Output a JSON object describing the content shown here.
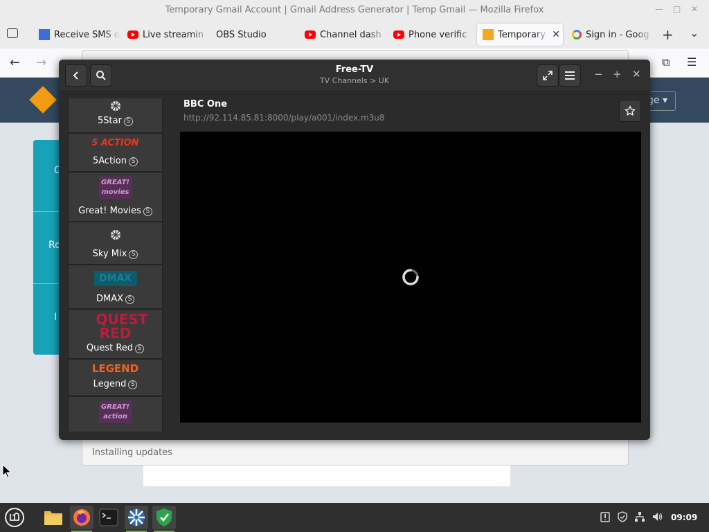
{
  "firefox": {
    "window_title": "Temporary Gmail Account | Gmail Address Generator | Temp Gmail — Mozilla Firefox",
    "tabs": [
      {
        "label": "Receive SMS o",
        "favicon": "sms-favicon"
      },
      {
        "label": "Live streamin",
        "favicon": "youtube-favicon"
      },
      {
        "label": "OBS Studio",
        "favicon": ""
      },
      {
        "label": "Channel dash",
        "favicon": "youtube-favicon"
      },
      {
        "label": "Phone verific",
        "favicon": "youtube-favicon"
      },
      {
        "label": "Temporary",
        "favicon": "mail-favicon",
        "active": true
      },
      {
        "label": "Sign in - Goog",
        "favicon": "google-favicon"
      }
    ],
    "close_glyph": "✕",
    "new_tab_glyph": "+",
    "tab_list_glyph": "⌄",
    "back_glyph": "←",
    "forward_glyph": "→",
    "menu_glyph": "☰"
  },
  "webpage": {
    "lang_button_label": "ge",
    "card_letters": [
      "C",
      "Ro",
      "I"
    ]
  },
  "update_dialog": {
    "status": "Installing updates"
  },
  "freetv": {
    "title": "Free-TV",
    "subtitle": "TV Channels > UK",
    "channels": [
      {
        "name": "5Star"
      },
      {
        "name": "5Action",
        "logo_text": "5 ACTION"
      },
      {
        "name": "Great! Movies",
        "logo_text": "GREAT! movies"
      },
      {
        "name": "Sky Mix"
      },
      {
        "name": "DMAX",
        "logo_text": "DMAX"
      },
      {
        "name": "Quest Red",
        "logo_text": "QUEST RED"
      },
      {
        "name": "Legend",
        "logo_text": "LEGEND"
      },
      {
        "name": "",
        "logo_text": "GREAT! action"
      }
    ],
    "subscribed_mark": "S",
    "selected": {
      "name": "BBC One",
      "url": "http://92.114.85.81:8000/play/a001/index.m3u8"
    },
    "colors": {
      "accent_red": "#e8351e",
      "legend_orange": "#f0641e",
      "purple": "#6b2d6b",
      "quest_red": "#c01b3a"
    }
  },
  "taskbar": {
    "apps": [
      "menu-icon",
      "files-icon",
      "firefox-icon",
      "terminal-icon",
      "freetv-icon",
      "vpn-shield-icon"
    ],
    "clock": "09:09"
  }
}
